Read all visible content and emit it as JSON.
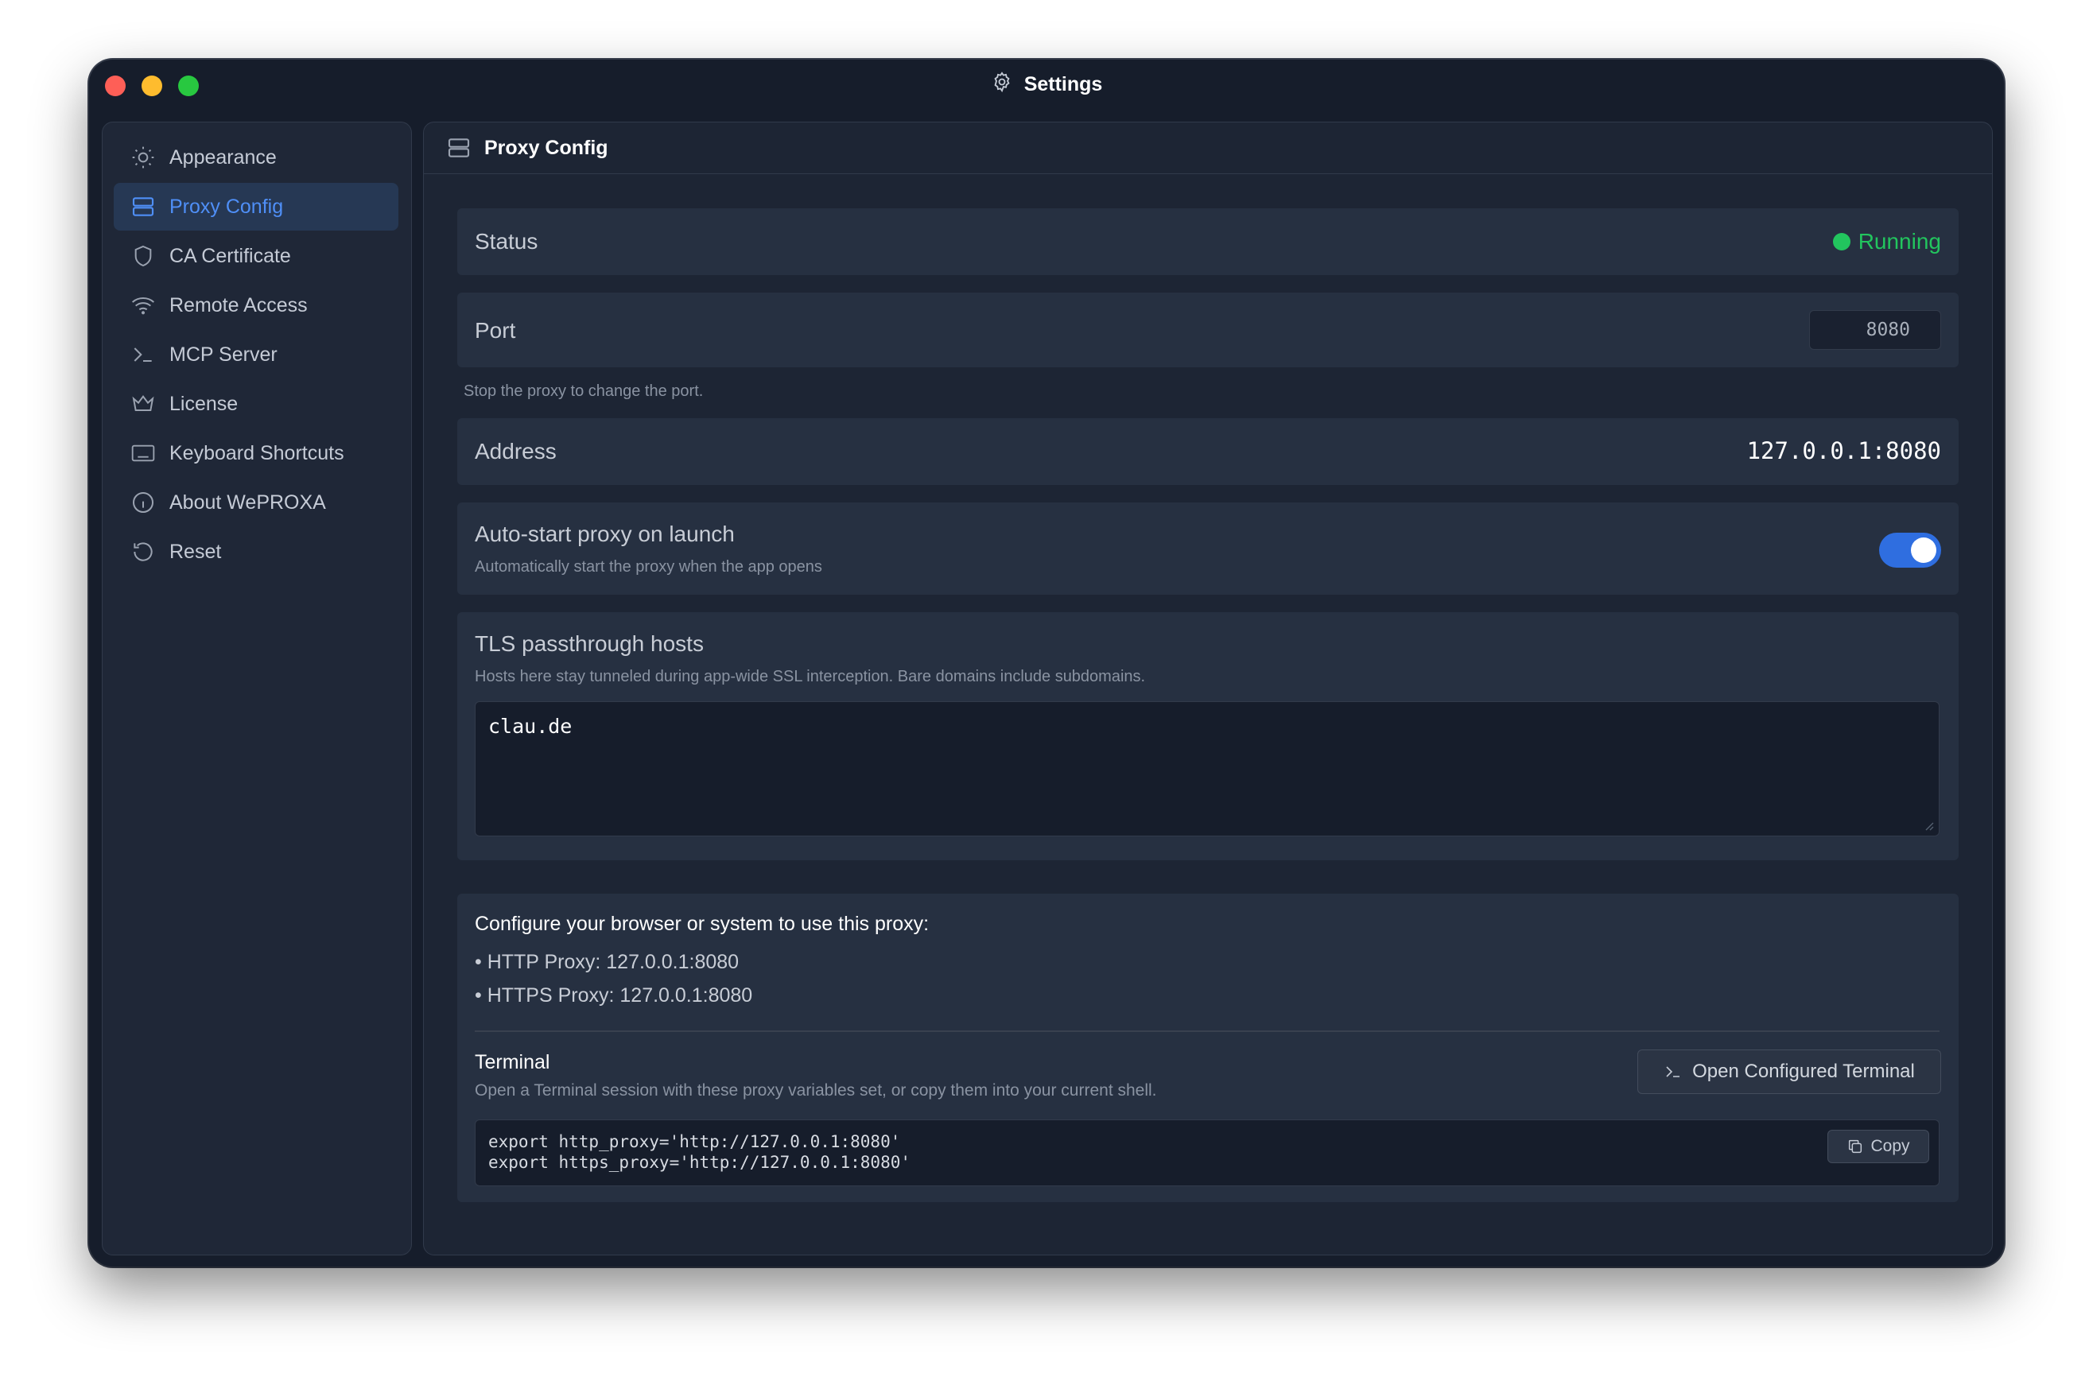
{
  "window": {
    "title": "Settings",
    "title_icon": "gear-icon"
  },
  "sidebar": {
    "items": [
      {
        "label": "Appearance",
        "icon": "sun-icon"
      },
      {
        "label": "Proxy Config",
        "icon": "server-icon",
        "active": true
      },
      {
        "label": "CA Certificate",
        "icon": "shield-icon"
      },
      {
        "label": "Remote Access",
        "icon": "wifi-icon"
      },
      {
        "label": "MCP Server",
        "icon": "terminal-icon"
      },
      {
        "label": "License",
        "icon": "crown-icon"
      },
      {
        "label": "Keyboard Shortcuts",
        "icon": "keyboard-icon"
      },
      {
        "label": "About WePROXA",
        "icon": "info-icon"
      },
      {
        "label": "Reset",
        "icon": "reset-icon"
      }
    ]
  },
  "main": {
    "header_title": "Proxy Config",
    "status": {
      "label": "Status",
      "value": "Running",
      "color": "#22c55e"
    },
    "port": {
      "label": "Port",
      "value": "8080",
      "hint": "Stop the proxy to change the port."
    },
    "address": {
      "label": "Address",
      "value": "127.0.0.1:8080"
    },
    "autostart": {
      "label": "Auto-start proxy on launch",
      "description": "Automatically start the proxy when the app opens",
      "enabled": true
    },
    "tls": {
      "label": "TLS passthrough hosts",
      "description": "Hosts here stay tunneled during app-wide SSL interception. Bare domains include subdomains.",
      "value": "clau.de"
    },
    "config_info": {
      "title": "Configure your browser or system to use this proxy:",
      "http_line": "• HTTP Proxy: 127.0.0.1:8080",
      "https_line": "• HTTPS Proxy: 127.0.0.1:8080"
    },
    "terminal": {
      "title": "Terminal",
      "description": "Open a Terminal session with these proxy variables set, or copy them into your current shell.",
      "open_button": "Open Configured Terminal",
      "code_line1": "export http_proxy='http://127.0.0.1:8080'",
      "code_line2": "export https_proxy='http://127.0.0.1:8080'",
      "copy_button": "Copy"
    }
  },
  "colors": {
    "accent": "#4f8ff7",
    "toggle_on": "#2f6ee0",
    "running": "#22c55e"
  }
}
